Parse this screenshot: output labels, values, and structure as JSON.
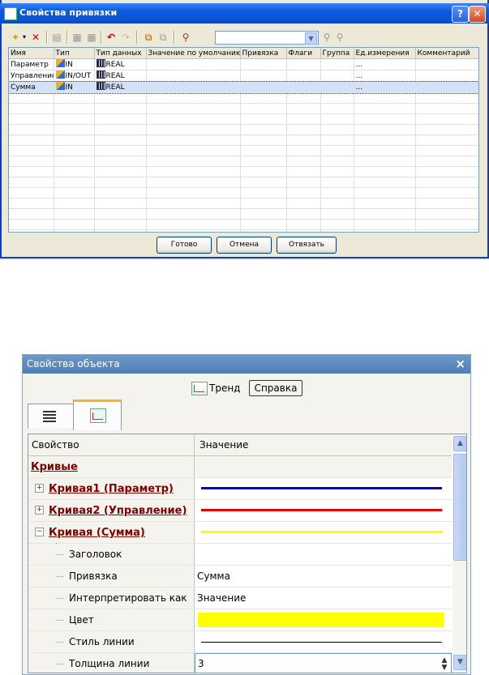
{
  "dialog1": {
    "title": "Свойства привязки",
    "help_glyph": "?",
    "close_glyph": "✕",
    "search_value": "",
    "columns": [
      "Имя",
      "Тип",
      "Тип данных",
      "Значение по умолчанию",
      "Привязка",
      "Флаги",
      "Группа",
      "Ед.измерения",
      "Комментарий"
    ],
    "rows": [
      {
        "name": "Параметр",
        "type": "IN",
        "dtype": "REAL",
        "unit": "..."
      },
      {
        "name": "Управление",
        "type": "IN/OUT",
        "dtype": "REAL",
        "unit": "..."
      },
      {
        "name": "Сумма",
        "type": "IN",
        "dtype": "REAL",
        "unit": "...",
        "selected": true
      }
    ],
    "buttons": {
      "done": "Готово",
      "cancel": "Отмена",
      "unbind": "Отвязать"
    }
  },
  "panel2": {
    "title": "Свойства объекта",
    "close_glyph": "×",
    "trend_label": "Тренд",
    "help_label": "Справка",
    "headers": {
      "property": "Свойство",
      "value": "Значение"
    },
    "category": "Кривые",
    "curves": [
      {
        "label": "Кривая1 (Параметр)",
        "expander": "+",
        "color": "#0000cc"
      },
      {
        "label": "Кривая2 (Управление)",
        "expander": "+",
        "color": "#dd0000"
      },
      {
        "label": "Кривая (Сумма)",
        "expander": "−",
        "color": "#ffff00"
      }
    ],
    "props": {
      "title_label": "Заголовок",
      "binding_label": "Привязка",
      "binding_value": "Сумма",
      "interp_label": "Интерпретировать как",
      "interp_value": "Значение",
      "color_label": "Цвет",
      "color_value": "#ffff00",
      "linestyle_label": "Стиль линии",
      "linewidth_label": "Толщина линии",
      "linewidth_value": "3"
    }
  }
}
